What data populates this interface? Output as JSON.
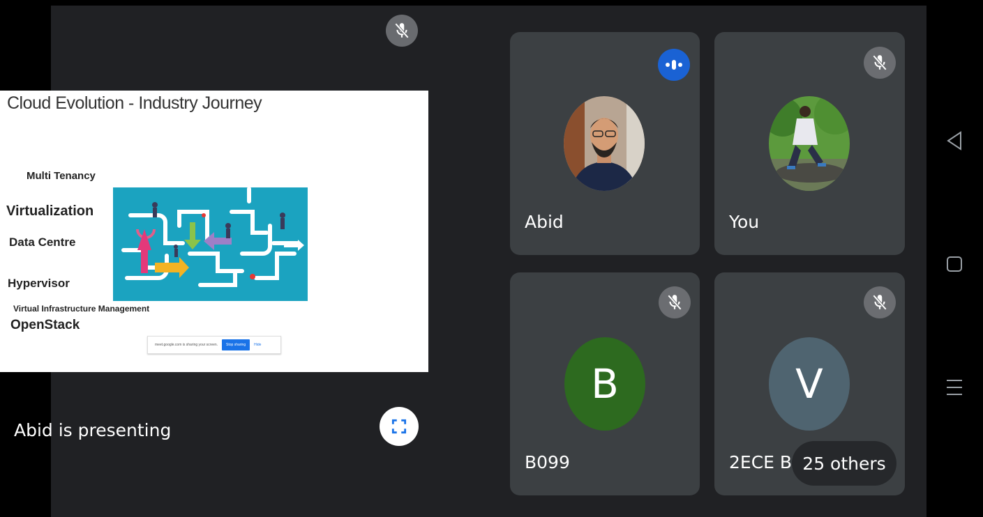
{
  "presentation": {
    "presenter_label": "Abid is presenting",
    "slide": {
      "title": "Cloud Evolution - Industry Journey",
      "items": [
        "Multi Tenancy",
        "Virtualization",
        "Data Centre",
        "Hypervisor",
        "Virtual Infrastructure Management",
        "OpenStack"
      ],
      "share_bar": {
        "text": "meet.google.com is sharing your screen.",
        "stop_label": "Stop sharing",
        "hide_label": "Hide"
      }
    }
  },
  "participants": [
    {
      "name": "Abid",
      "status": "speaking"
    },
    {
      "name": "You",
      "status": "muted"
    },
    {
      "name": "B099",
      "initial": "B",
      "avatar_color": "#2d6a1f",
      "status": "muted"
    },
    {
      "name": "2ECE B 0",
      "initial": "V",
      "avatar_color": "#4f6470",
      "status": "muted"
    }
  ],
  "others": {
    "label": "25 others"
  },
  "colors": {
    "stage": "#202124",
    "tile": "#3c4043",
    "accent": "#1a73e8"
  }
}
